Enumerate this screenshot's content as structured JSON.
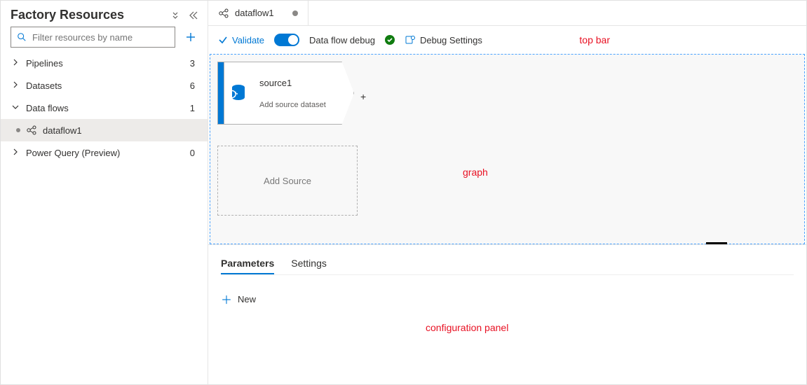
{
  "sidebar": {
    "title": "Factory Resources",
    "filter_placeholder": "Filter resources by name",
    "items": [
      {
        "label": "Pipelines",
        "count": "3",
        "expanded": false
      },
      {
        "label": "Datasets",
        "count": "6",
        "expanded": false
      },
      {
        "label": "Data flows",
        "count": "1",
        "expanded": true,
        "children": [
          {
            "label": "dataflow1",
            "dirty": true
          }
        ]
      },
      {
        "label": "Power Query (Preview)",
        "count": "0",
        "expanded": false
      }
    ]
  },
  "tab": {
    "label": "dataflow1"
  },
  "toolbar": {
    "validate": "Validate",
    "debug_label": "Data flow debug",
    "debug_settings": "Debug Settings"
  },
  "canvas": {
    "node": {
      "name": "source1",
      "subtitle": "Add source dataset"
    },
    "add_source": "Add Source"
  },
  "config": {
    "tabs": [
      "Parameters",
      "Settings"
    ],
    "active_tab": 0,
    "new_label": "New"
  },
  "annotations": {
    "topbar": "top bar",
    "graph": "graph",
    "config": "configuration panel"
  }
}
